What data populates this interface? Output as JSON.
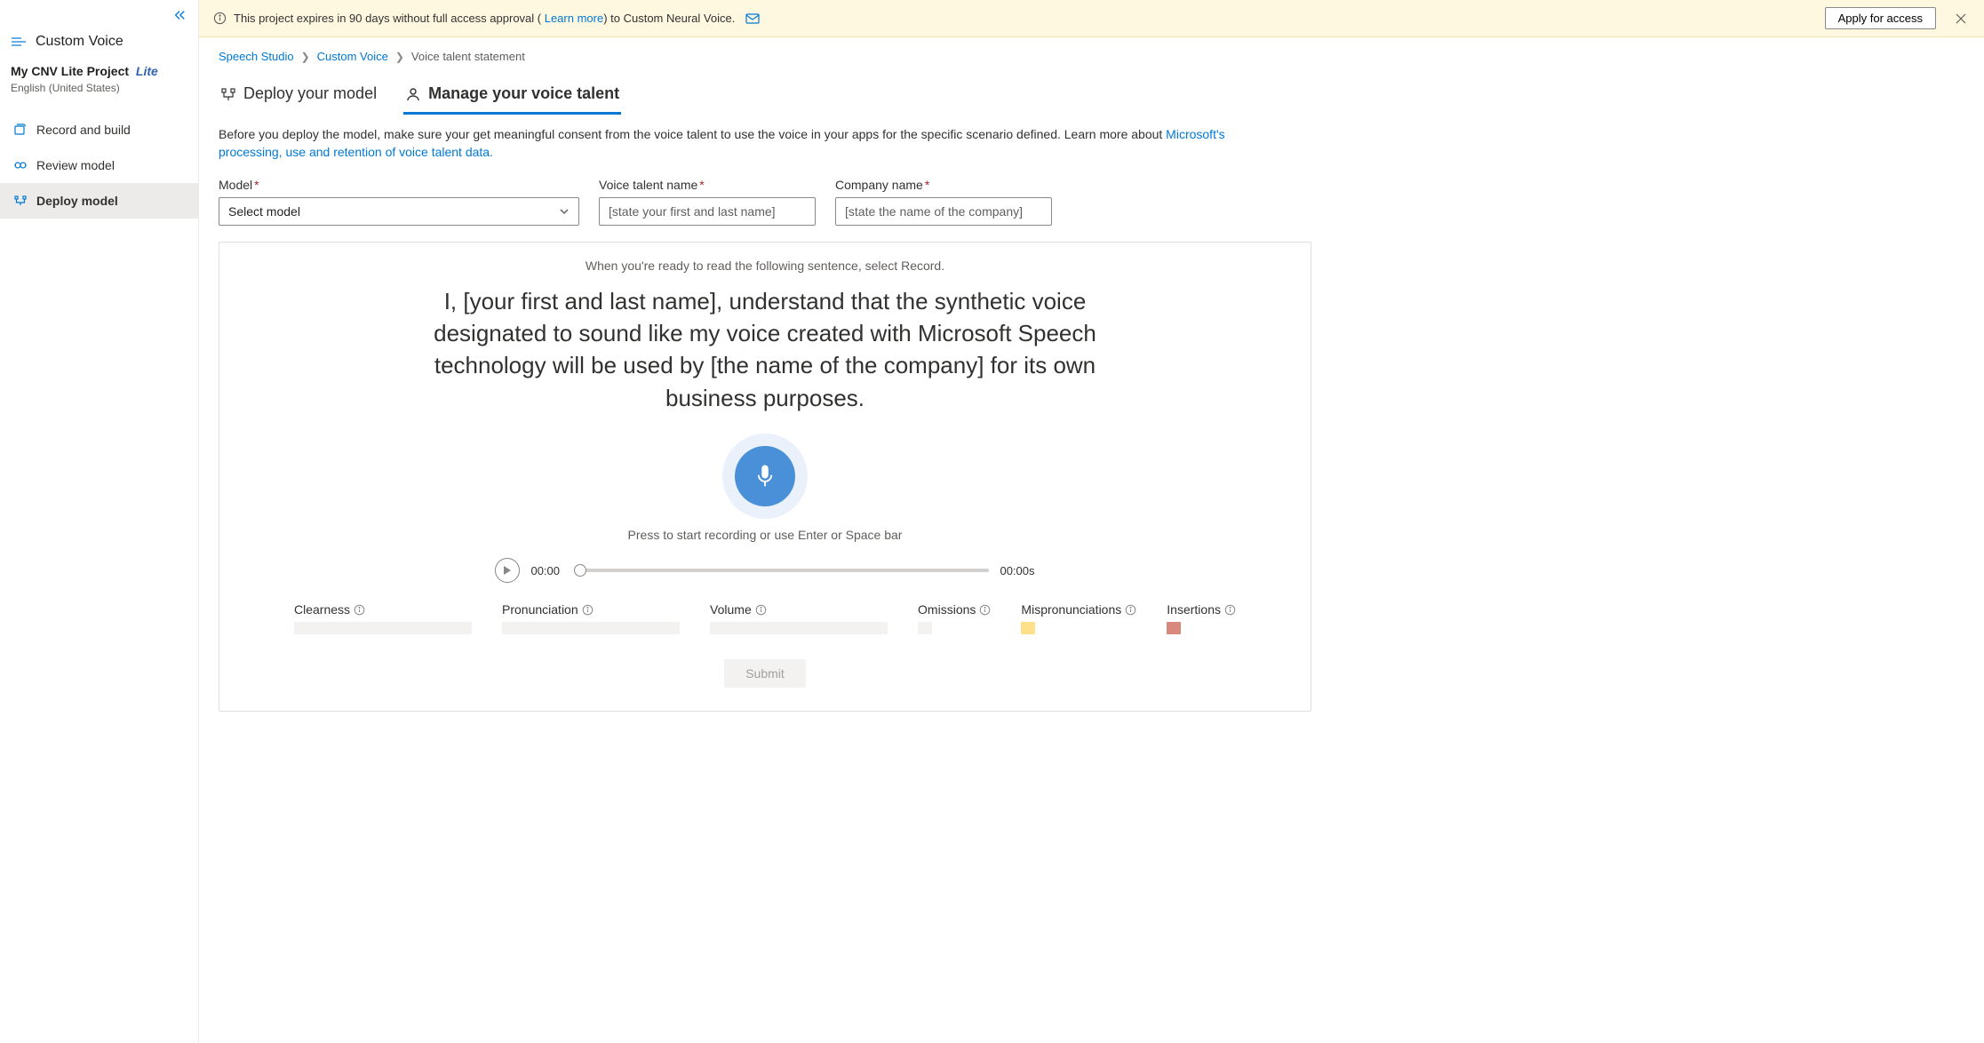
{
  "notice": {
    "text_before_link": "This project expires in 90 days without full access approval ( ",
    "learn_more": "Learn more",
    "text_after_link": ") to Custom Neural Voice.",
    "apply_btn": "Apply for access"
  },
  "sidebar": {
    "title": "Custom Voice",
    "project_name": "My CNV Lite Project",
    "project_badge": "Lite",
    "project_lang": "English (United States)",
    "nav": [
      {
        "label": "Record and build"
      },
      {
        "label": "Review model"
      },
      {
        "label": "Deploy model"
      }
    ]
  },
  "breadcrumb": {
    "a": "Speech Studio",
    "b": "Custom Voice",
    "c": "Voice talent statement"
  },
  "tabs": {
    "deploy": "Deploy your model",
    "manage": "Manage your voice talent"
  },
  "desc": {
    "main": "Before you deploy the model, make sure your get meaningful consent from the voice talent to use the voice in your apps for the specific scenario defined. Learn more about ",
    "link": "Microsoft's processing, use and retention of voice talent data."
  },
  "form": {
    "model_label": "Model",
    "model_placeholder": "Select model",
    "talent_label": "Voice talent name",
    "talent_placeholder": "[state your first and last name]",
    "company_label": "Company name",
    "company_placeholder": "[state the name of the company]"
  },
  "record": {
    "hint": "When you're ready to read the following sentence, select Record.",
    "statement": "I, [your first and last name], understand that the synthetic voice designated to sound like my voice created with Microsoft Speech technology will be used by [the name of the company] for its own business purposes.",
    "press_hint": "Press to start recording or use Enter or Space bar",
    "time": "00:00",
    "duration": "00:00s",
    "metrics": {
      "clearness": "Clearness",
      "pronunciation": "Pronunciation",
      "volume": "Volume",
      "omissions": "Omissions",
      "mispron": "Mispronunciations",
      "insertions": "Insertions"
    },
    "submit": "Submit"
  }
}
